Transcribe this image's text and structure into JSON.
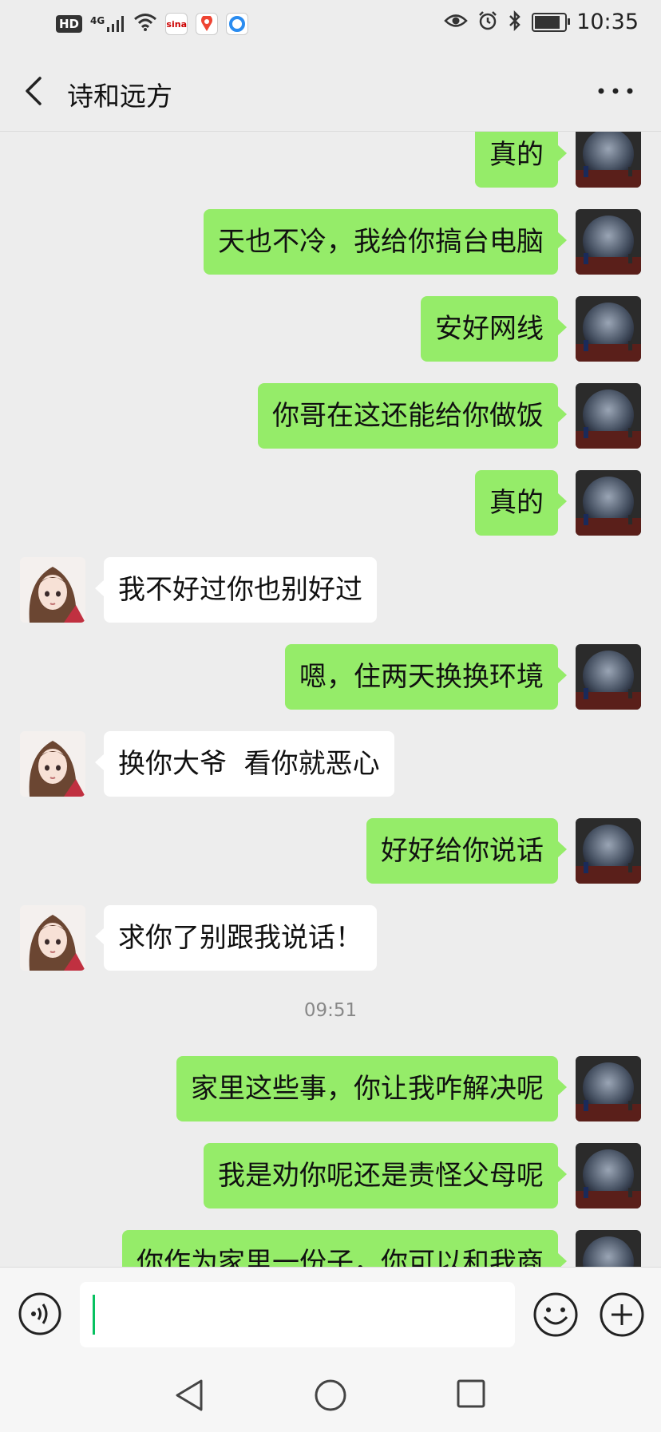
{
  "status_bar": {
    "hd": "HD",
    "network": "4G",
    "time": "10:35",
    "battery_level": 0.9,
    "icons": [
      "hd-icon",
      "signal-icon",
      "wifi-icon",
      "sina-app-icon",
      "baidu-map-icon",
      "browser-icon",
      "eye-icon",
      "alarm-icon",
      "bluetooth-icon",
      "battery-icon"
    ]
  },
  "header": {
    "title": "诗和远方",
    "back_icon": "chevron-left-icon",
    "more_icon": "more-horizontal-icon"
  },
  "colors": {
    "background": "#ededed",
    "my_bubble": "#95ec69",
    "other_bubble": "#ffffff",
    "cursor": "#07c160"
  },
  "messages": {
    "m1": {
      "sender": "me",
      "text": "真的"
    },
    "m2": {
      "sender": "me",
      "text": "天也不冷，我给你搞台电脑"
    },
    "m3": {
      "sender": "me",
      "text": "安好网线"
    },
    "m4": {
      "sender": "me",
      "text": "你哥在这还能给你做饭"
    },
    "m5": {
      "sender": "me",
      "text": "真的"
    },
    "m6": {
      "sender": "other",
      "text": "我不好过你也别好过"
    },
    "m7": {
      "sender": "me",
      "text": "嗯，住两天换换环境"
    },
    "m8": {
      "sender": "other",
      "text": "换你大爷  看你就恶心"
    },
    "m9": {
      "sender": "me",
      "text": "好好给你说话"
    },
    "m10": {
      "sender": "other",
      "text": "求你了别跟我说话！"
    },
    "timestamp": "09:51",
    "m11": {
      "sender": "me",
      "text": "家里这些事，你让我咋解决呢"
    },
    "m12": {
      "sender": "me",
      "text": "我是劝你呢还是责怪父母呢"
    },
    "m13": {
      "sender": "me",
      "text": "你作为家里一份子，你可以和我商"
    }
  },
  "input_bar": {
    "value": "",
    "voice_icon": "voice-icon",
    "emoji_icon": "emoji-icon",
    "plus_icon": "plus-circle-icon"
  },
  "nav_bar": {
    "icons": [
      "nav-back-icon",
      "nav-home-icon",
      "nav-recent-icon"
    ]
  }
}
